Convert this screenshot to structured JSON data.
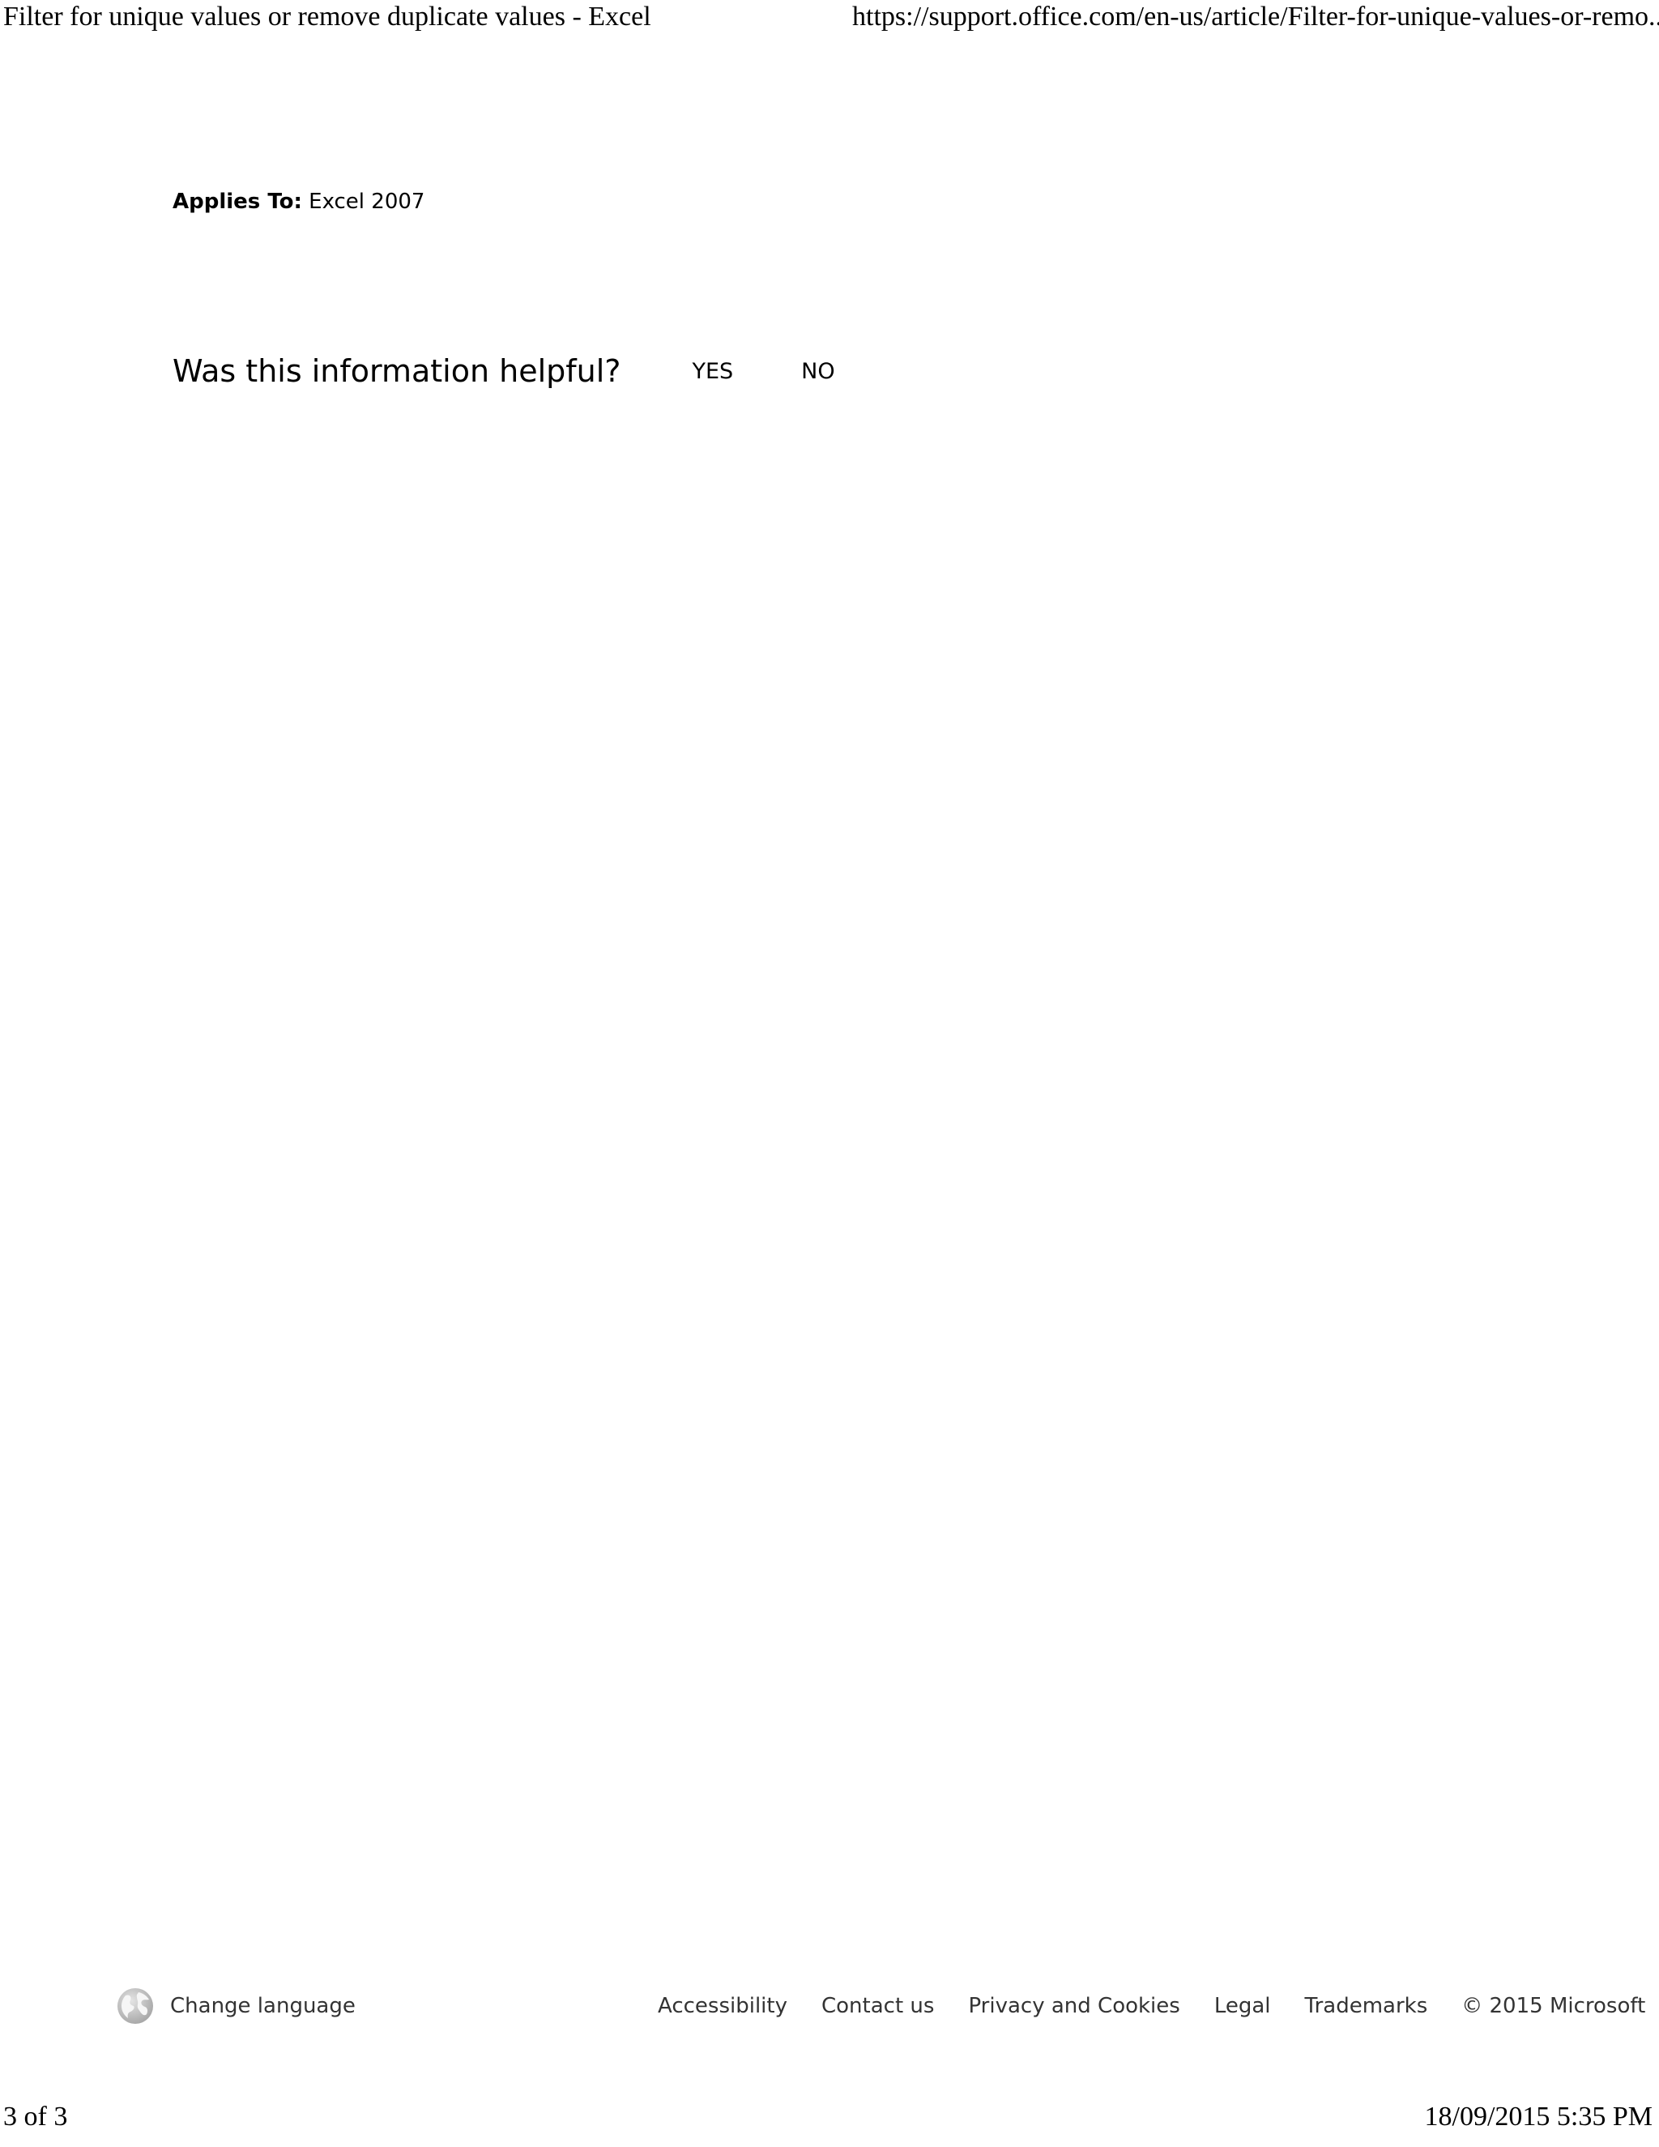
{
  "print_header": {
    "title": "Filter for unique values or remove duplicate values - Excel",
    "url": "https://support.office.com/en-us/article/Filter-for-unique-values-or-remo..."
  },
  "applies_to": {
    "label": "Applies To:",
    "value": " Excel 2007"
  },
  "feedback": {
    "question": "Was this information helpful?",
    "yes_label": "YES",
    "no_label": "NO"
  },
  "footer": {
    "change_language": "Change language",
    "globe_icon": "globe-icon",
    "links": [
      "Accessibility",
      "Contact us",
      "Privacy and Cookies",
      "Legal",
      "Trademarks"
    ],
    "copyright": "© 2015 Microsoft"
  },
  "print_footer": {
    "page": "3 of 3",
    "datetime": "18/09/2015 5:35 PM"
  }
}
